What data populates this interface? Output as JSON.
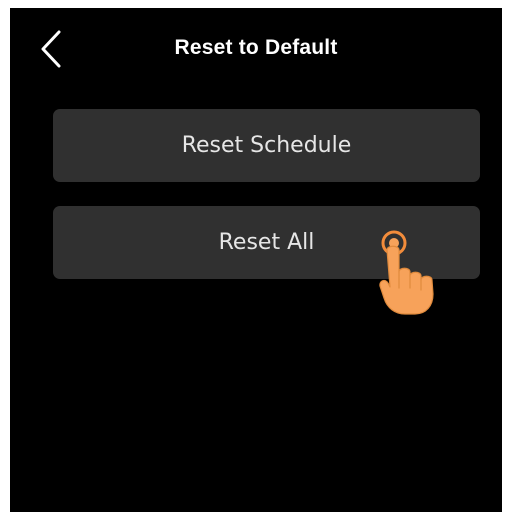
{
  "header": {
    "title": "Reset to Default",
    "back_icon": "chevron-left-icon"
  },
  "menu": {
    "items": [
      {
        "label": "Reset Schedule"
      },
      {
        "label": "Reset All"
      }
    ]
  },
  "overlay": {
    "icon": "tap-hand-icon"
  },
  "colors": {
    "background": "#000000",
    "button": "#303030",
    "button_text": "#e6e6e6",
    "title_text": "#ffffff",
    "hand_fill": "#f7a25a",
    "hand_ring": "#f28c3b"
  }
}
